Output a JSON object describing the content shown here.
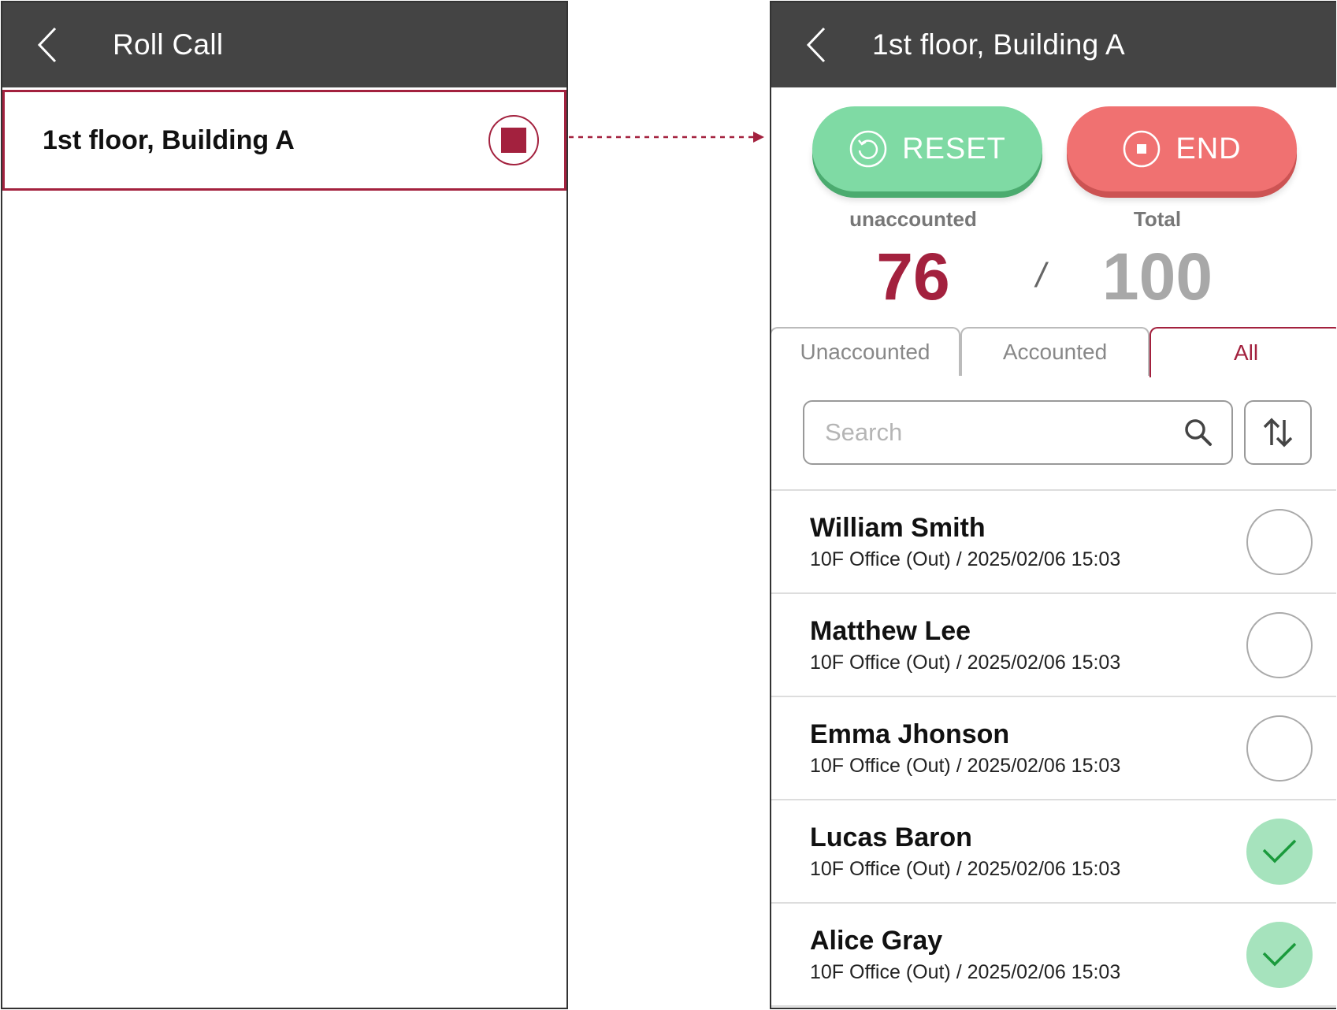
{
  "left": {
    "header": {
      "title": "Roll Call"
    },
    "item": {
      "label": "1st floor, Building A"
    }
  },
  "right": {
    "header": {
      "title": "1st floor, Building A"
    },
    "actions": {
      "reset_label": "RESET",
      "end_label": "END"
    },
    "stats": {
      "unaccounted_label": "unaccounted",
      "unaccounted_value": "76",
      "separator": "/",
      "total_label": "Total",
      "total_value": "100"
    },
    "tabs": [
      {
        "label": "Unaccounted"
      },
      {
        "label": "Accounted"
      },
      {
        "label": "All",
        "selected": true
      }
    ],
    "search": {
      "placeholder": "Search"
    },
    "people": [
      {
        "name": "William Smith",
        "detail": "10F Office (Out) / 2025/02/06 15:03",
        "accounted": false
      },
      {
        "name": "Matthew Lee",
        "detail": "10F Office (Out) / 2025/02/06 15:03",
        "accounted": false
      },
      {
        "name": "Emma Jhonson",
        "detail": "10F Office (Out) / 2025/02/06 15:03",
        "accounted": false
      },
      {
        "name": "Lucas Baron",
        "detail": "10F Office (Out) / 2025/02/06 15:03",
        "accounted": true
      },
      {
        "name": "Alice Gray",
        "detail": "10F Office (Out) / 2025/02/06 15:03",
        "accounted": true
      }
    ]
  },
  "colors": {
    "header_bg": "#444444",
    "accent": "#a3213e",
    "reset_green": "#7fdaa4",
    "end_red": "#f07171",
    "check_green": "#a6e3bd"
  },
  "icons": [
    "back-icon",
    "stop-icon",
    "reset-icon",
    "end-icon",
    "search-icon",
    "sort-icon",
    "check-icon"
  ]
}
